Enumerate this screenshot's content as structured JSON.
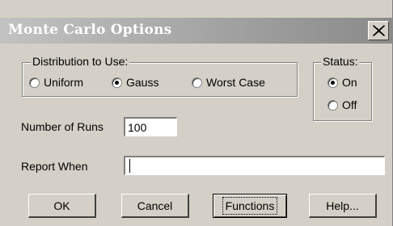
{
  "window": {
    "title": "Monte Carlo Options",
    "close_icon": "close-icon"
  },
  "distribution": {
    "legend": "Distribution to Use:",
    "options": [
      {
        "label": "Uniform",
        "checked": false
      },
      {
        "label": "Gauss",
        "checked": true
      },
      {
        "label": "Worst Case",
        "checked": false
      }
    ]
  },
  "status": {
    "legend": "Status:",
    "options": [
      {
        "label": "On",
        "checked": true
      },
      {
        "label": "Off",
        "checked": false
      }
    ]
  },
  "runs": {
    "label": "Number of Runs",
    "value": "100"
  },
  "report": {
    "label": "Report When",
    "value": ""
  },
  "buttons": {
    "ok": "OK",
    "cancel": "Cancel",
    "functions": "Functions",
    "help": "Help..."
  }
}
